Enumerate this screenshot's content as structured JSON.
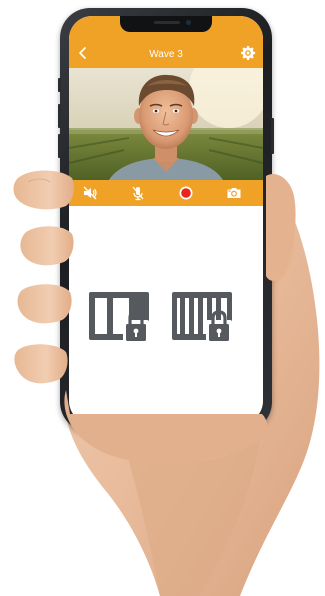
{
  "header": {
    "title": "Wave 3",
    "back_icon": "chevron-left-icon",
    "settings_icon": "gear-icon"
  },
  "video_feed": {
    "description_icon": "camera-feed"
  },
  "controls": [
    {
      "name": "speaker-mute-button",
      "icon": "speaker-muted-icon"
    },
    {
      "name": "mic-mute-button",
      "icon": "microphone-muted-icon"
    },
    {
      "name": "record-button",
      "icon": "record-icon"
    },
    {
      "name": "snapshot-button",
      "icon": "camera-icon"
    }
  ],
  "locks": [
    {
      "name": "door-unlock-button",
      "icon": "door-lock-icon"
    },
    {
      "name": "gate-unlock-button",
      "icon": "gate-lock-icon"
    }
  ],
  "colors": {
    "accent": "#f0a226",
    "icon_dark": "#55585c",
    "record_red": "#e8261c",
    "screen_bg": "#ffffff"
  }
}
